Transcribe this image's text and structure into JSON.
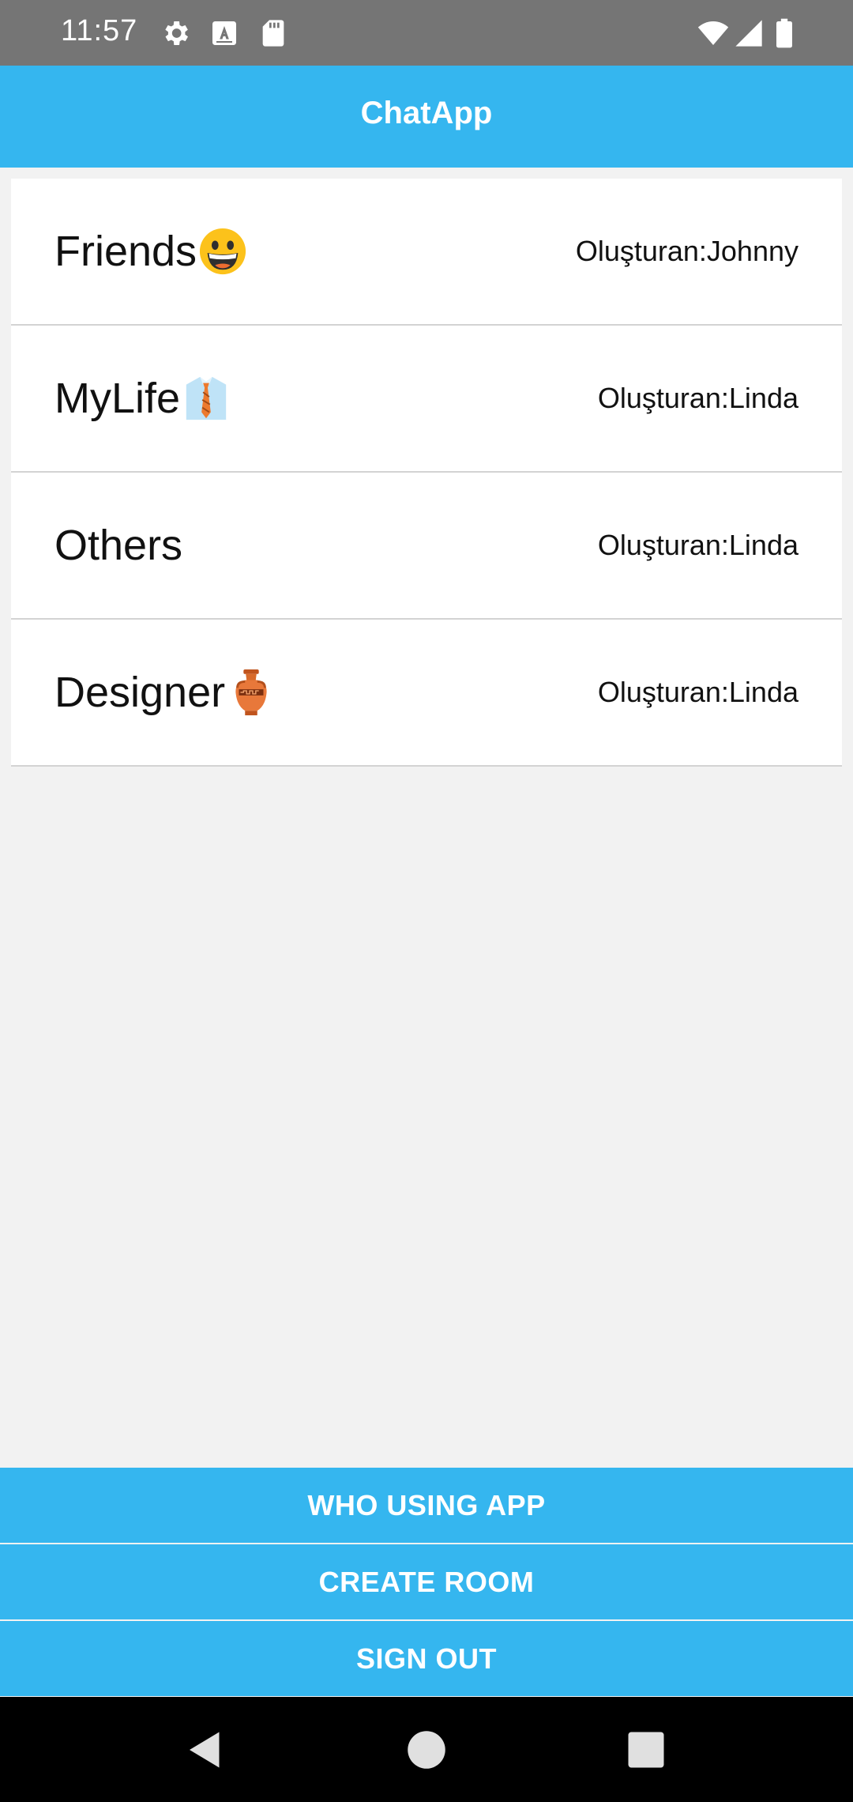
{
  "status_bar": {
    "time": "11:57",
    "icons": [
      "gear-icon",
      "a-keyboard-icon",
      "sd-card-icon",
      "wifi-icon",
      "signal-icon",
      "battery-icon"
    ]
  },
  "app_bar": {
    "title": "ChatApp",
    "color": "#35b6ef"
  },
  "rooms": [
    {
      "name": "Friends",
      "emoji": "grinning-face-emoji",
      "creator": "Oluşturan:Johnny"
    },
    {
      "name": "MyLife",
      "emoji": "shirt-tie-emoji",
      "creator": "Oluşturan:Linda"
    },
    {
      "name": "Others",
      "emoji": "",
      "creator": "Oluşturan:Linda"
    },
    {
      "name": "Designer",
      "emoji": "amphora-emoji",
      "creator": "Oluşturan:Linda"
    }
  ],
  "actions": {
    "who_using": "WHO USING APP",
    "create_room": "CREATE ROOM",
    "sign_out": "SIGN OUT"
  },
  "nav_bar": {
    "icons": [
      "back-triangle-icon",
      "home-circle-icon",
      "recents-square-icon"
    ]
  }
}
